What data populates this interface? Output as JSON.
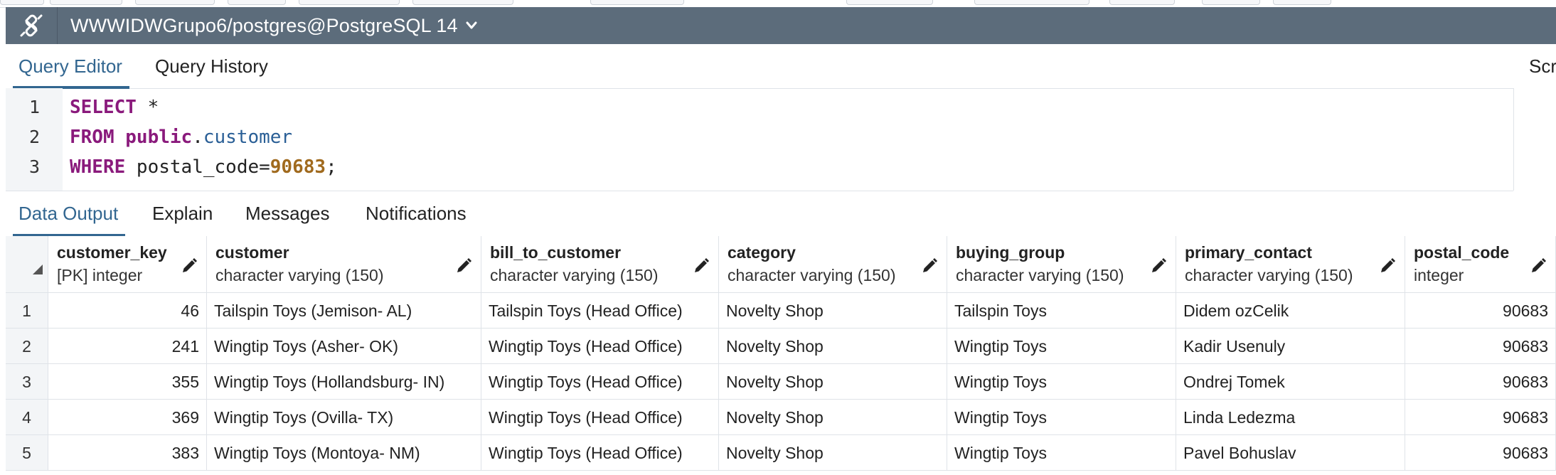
{
  "connection": {
    "title": "WWWIDWGrupo6/postgres@PostgreSQL 14",
    "icon": "connection-icon"
  },
  "editor_tabs": {
    "query_editor": "Query Editor",
    "query_history": "Query History",
    "scratch_pad_partial": "Scr"
  },
  "editor": {
    "line_numbers": [
      "1",
      "2",
      "3"
    ],
    "line1": {
      "keyword": "SELECT",
      "rest": " *"
    },
    "line2": {
      "keyword": "FROM",
      "schema": "public",
      "dot": ".",
      "table": "customer"
    },
    "line3": {
      "keyword": "WHERE",
      "column": " postal_code=",
      "value": "90683",
      "end": ";"
    }
  },
  "output_tabs": {
    "data_output": "Data Output",
    "explain": "Explain",
    "messages": "Messages",
    "notifications": "Notifications"
  },
  "grid": {
    "columns": [
      {
        "name": "customer_key",
        "type": "[PK] integer"
      },
      {
        "name": "customer",
        "type": "character varying (150)"
      },
      {
        "name": "bill_to_customer",
        "type": "character varying (150)"
      },
      {
        "name": "category",
        "type": "character varying (150)"
      },
      {
        "name": "buying_group",
        "type": "character varying (150)"
      },
      {
        "name": "primary_contact",
        "type": "character varying (150)"
      },
      {
        "name": "postal_code",
        "type": "integer"
      }
    ],
    "rows": [
      {
        "num": "1",
        "cells": [
          "46",
          "Tailspin Toys (Jemison- AL)",
          "Tailspin Toys (Head Office)",
          "Novelty Shop",
          "Tailspin Toys",
          "Didem ozCelik",
          "90683"
        ]
      },
      {
        "num": "2",
        "cells": [
          "241",
          "Wingtip Toys (Asher- OK)",
          "Wingtip Toys (Head Office)",
          "Novelty Shop",
          "Wingtip Toys",
          "Kadir Usenuly",
          "90683"
        ]
      },
      {
        "num": "3",
        "cells": [
          "355",
          "Wingtip Toys (Hollandsburg- IN)",
          "Wingtip Toys (Head Office)",
          "Novelty Shop",
          "Wingtip Toys",
          "Ondrej Tomek",
          "90683"
        ]
      },
      {
        "num": "4",
        "cells": [
          "369",
          "Wingtip Toys (Ovilla- TX)",
          "Wingtip Toys (Head Office)",
          "Novelty Shop",
          "Wingtip Toys",
          "Linda Ledezma",
          "90683"
        ]
      },
      {
        "num": "5",
        "cells": [
          "383",
          "Wingtip Toys (Montoya- NM)",
          "Wingtip Toys (Head Office)",
          "Novelty Shop",
          "Wingtip Toys",
          "Pavel Bohuslav",
          "90683"
        ]
      }
    ]
  },
  "colors": {
    "titlebar": "#5c6c7b",
    "accent": "#326690",
    "keyword": "#8a1a7c",
    "identifier": "#2a5f96",
    "number": "#a06a1e"
  }
}
